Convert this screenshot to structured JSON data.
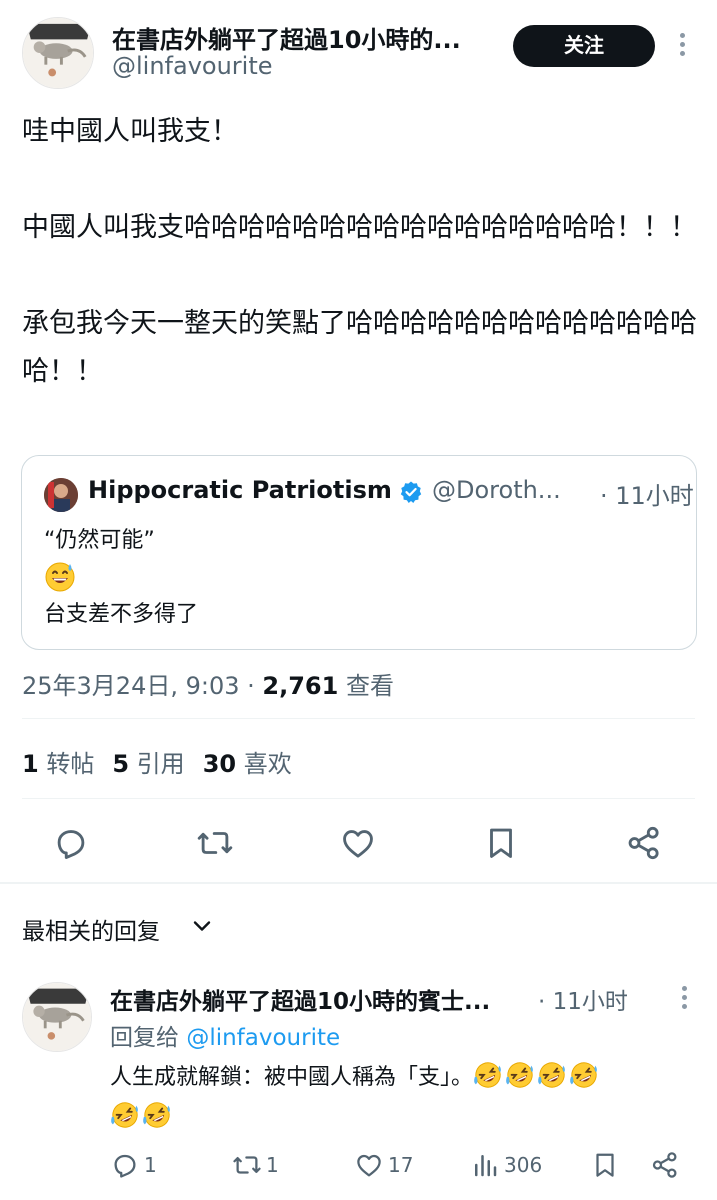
{
  "tweet": {
    "author_name": "在書店外躺平了超過10小時的...",
    "author_handle": "@linfavourite",
    "follow_label": "关注",
    "text": "哇中國人叫我支！\n\n中國人叫我支哈哈哈哈哈哈哈哈哈哈哈哈哈哈哈哈！！！\n\n承包我今天一整天的笑點了哈哈哈哈哈哈哈哈哈哈哈哈哈哈！！"
  },
  "quote": {
    "name": "Hippocratic Patriotism",
    "handle": "@Doroth...",
    "time": "· 11小时",
    "line1": "“仍然可能”",
    "line3": "台支差不多得了"
  },
  "meta": {
    "date": "25年3月24日, 9:03 · ",
    "views": "2,761",
    "views_label": " 查看"
  },
  "stats": {
    "reposts": "1",
    "reposts_label": " 转帖",
    "quotes": "5",
    "quotes_label": " 引用",
    "likes": "30",
    "likes_label": " 喜欢"
  },
  "sort": {
    "label": "最相关的回复"
  },
  "reply": {
    "author_name": "在書店外躺平了超過10小時的賓士...",
    "time": "· 11小时",
    "reply_to_label": "回复给 ",
    "reply_to_handle": "@linfavourite",
    "text": "人生成就解鎖：被中國人稱為「支」。",
    "replies": "1",
    "reposts": "1",
    "likes": "17",
    "views": "306"
  },
  "colors": {
    "text": "#0f1419",
    "secondary": "#536471",
    "link": "#1d9bf0",
    "divider": "#eff3f4",
    "verified": "#1d9bf0"
  },
  "icons": [
    "more-icon",
    "verified-icon",
    "reply-icon",
    "repost-icon",
    "like-icon",
    "bookmark-icon",
    "share-icon",
    "chevron-down-icon",
    "views-icon",
    "emoji-sweat-smile",
    "emoji-rofl"
  ]
}
